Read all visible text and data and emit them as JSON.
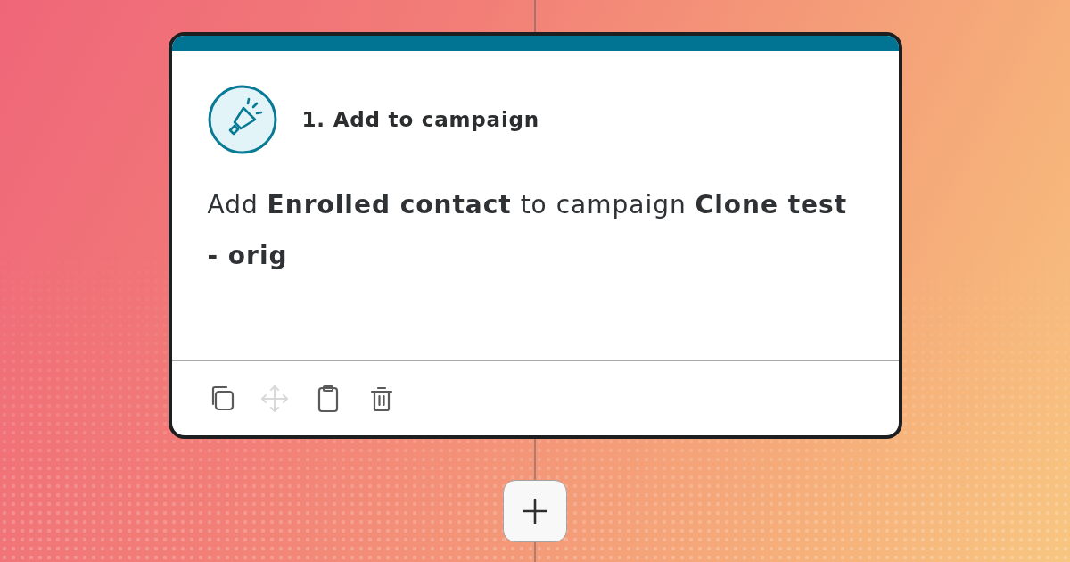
{
  "action_card": {
    "step_title": "1. Add to campaign",
    "description": "Add **Enrolled contact** to campaign **Clone test - orig**",
    "toolbar": [
      {
        "kind": "copy",
        "disabled": false
      },
      {
        "kind": "move",
        "disabled": true
      },
      {
        "kind": "paste",
        "disabled": false
      },
      {
        "kind": "delete",
        "disabled": false
      }
    ]
  }
}
